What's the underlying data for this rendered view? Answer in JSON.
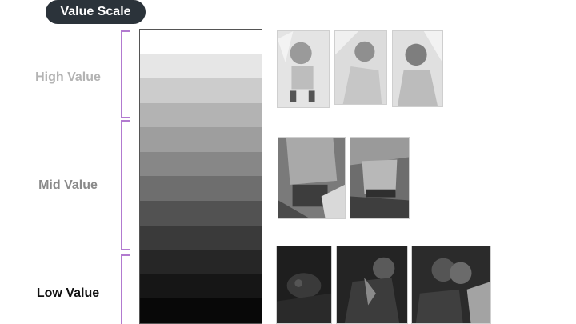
{
  "title": "Value Scale",
  "ranges": [
    {
      "label": "High Value",
      "color": "#b3b3b3"
    },
    {
      "label": "Mid Value",
      "color": "#8a8a8a"
    },
    {
      "label": "Low Value",
      "color": "#111111"
    }
  ],
  "accent_color": "#b27ad0",
  "value_steps": [
    "#ffffff",
    "#e6e6e6",
    "#cccccc",
    "#b3b3b3",
    "#9e9e9e",
    "#878787",
    "#6e6e6e",
    "#525252",
    "#3a3a3a",
    "#262626",
    "#161616",
    "#080808"
  ],
  "photos": {
    "high": [
      "light-value-illustration-1",
      "light-value-illustration-2",
      "light-value-illustration-3"
    ],
    "mid": [
      "mid-value-illustration-1",
      "mid-value-illustration-2"
    ],
    "low": [
      "dark-value-illustration-1",
      "dark-value-illustration-2",
      "dark-value-illustration-3"
    ]
  }
}
